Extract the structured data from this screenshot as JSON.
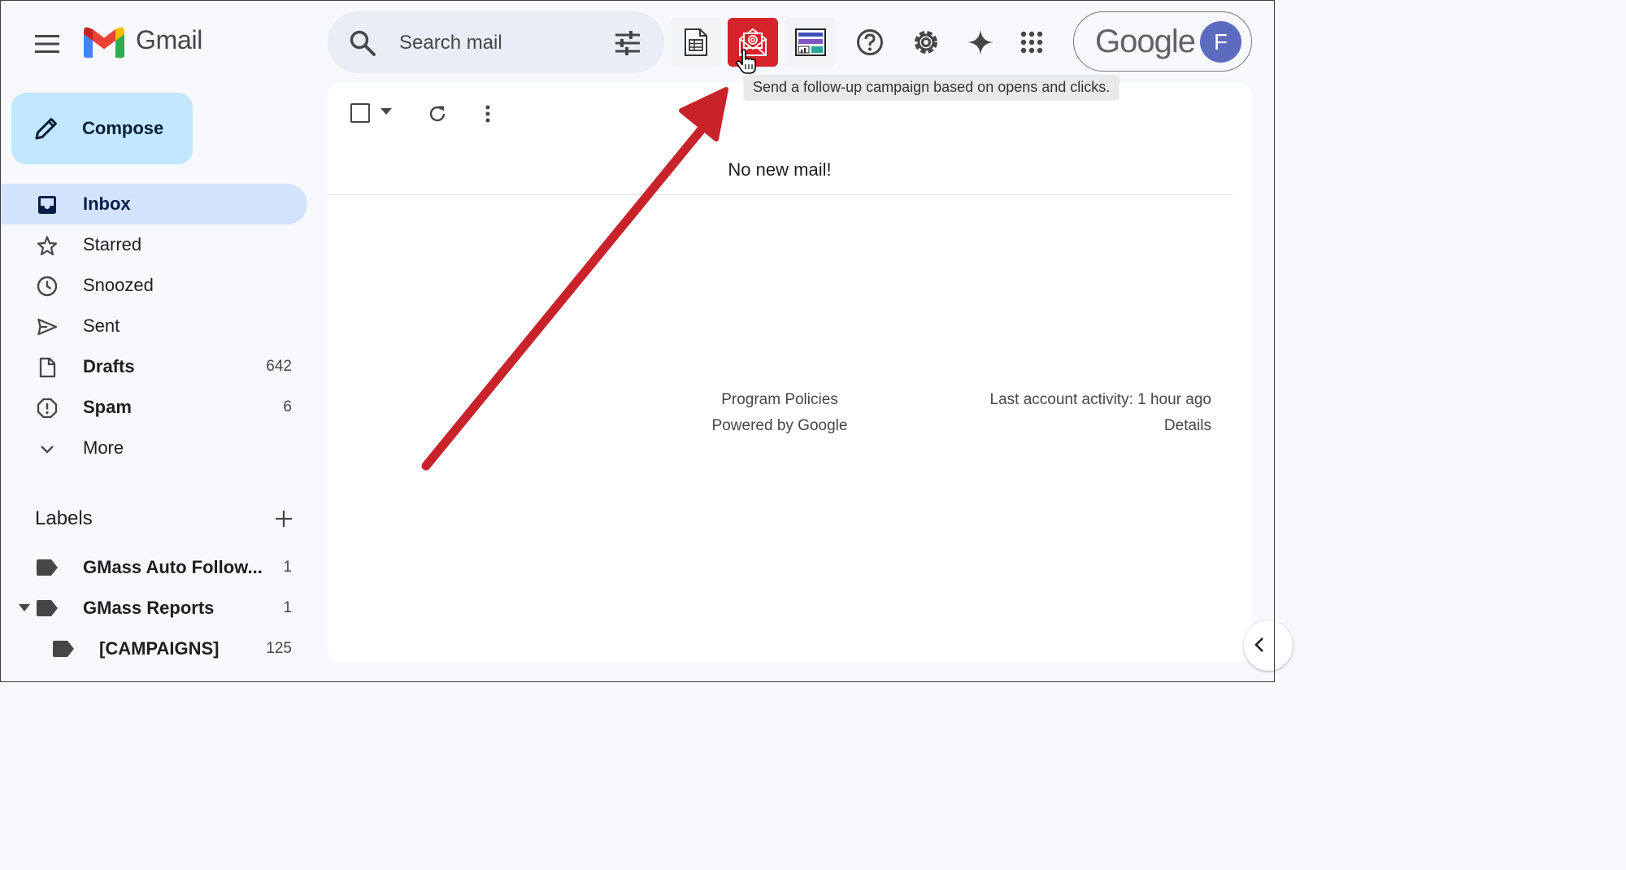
{
  "header": {
    "brand": "Gmail",
    "search_placeholder": "Search mail",
    "tooltip": "Send a follow-up campaign based on opens and clicks.",
    "account_logo": "Google",
    "avatar_initial": "F"
  },
  "toolbar_icons": [
    "menu-icon",
    "search-icon",
    "tune-icon",
    "sheets-icon",
    "campaign-icon",
    "reports-icon",
    "help-icon",
    "settings-icon",
    "gemini-icon",
    "apps-icon"
  ],
  "sidebar": {
    "compose": "Compose",
    "items": [
      {
        "label": "Inbox",
        "count": "",
        "icon": "inbox-icon"
      },
      {
        "label": "Starred",
        "count": "",
        "icon": "star-icon"
      },
      {
        "label": "Snoozed",
        "count": "",
        "icon": "clock-icon"
      },
      {
        "label": "Sent",
        "count": "",
        "icon": "send-icon"
      },
      {
        "label": "Drafts",
        "count": "642",
        "icon": "draft-icon"
      },
      {
        "label": "Spam",
        "count": "6",
        "icon": "spam-icon"
      },
      {
        "label": "More",
        "count": "",
        "icon": "chevron-down-icon"
      }
    ],
    "labels_heading": "Labels",
    "labels": [
      {
        "label": "GMass Auto Follow...",
        "count": "1"
      },
      {
        "label": "GMass Reports",
        "count": "1"
      },
      {
        "label": "[CAMPAIGNS]",
        "count": "125"
      }
    ]
  },
  "main": {
    "empty_message": "No new mail!",
    "footer": {
      "policies": "Program Policies",
      "powered": "Powered by Google",
      "activity": "Last account activity: 1 hour ago",
      "details": "Details"
    }
  },
  "colors": {
    "accent_red": "#d7232c",
    "compose_bg": "#c2e7ff",
    "active_nav": "#d3e3fd",
    "avatar": "#5c6bc0"
  }
}
